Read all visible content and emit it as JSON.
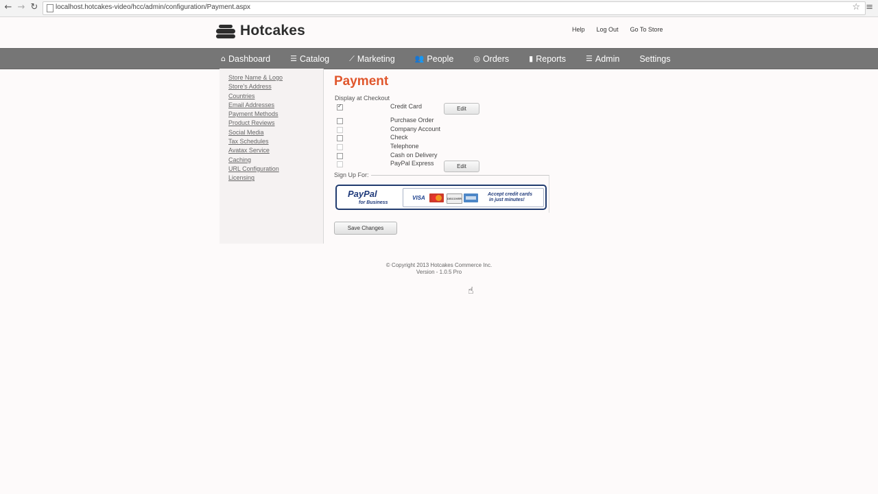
{
  "browser": {
    "url": "localhost.hotcakes-video/hcc/admin/configuration/Payment.aspx",
    "back_icon": "←",
    "forward_icon": "→",
    "reload_icon": "↻",
    "star_icon": "☆",
    "menu_icon": "≡"
  },
  "header": {
    "logo_text": "Hotcakes",
    "links": [
      "Help",
      "Log Out",
      "Go To Store"
    ]
  },
  "nav": {
    "items": [
      {
        "icon": "⌂",
        "label": "Dashboard"
      },
      {
        "icon": "☰",
        "label": "Catalog"
      },
      {
        "icon": "⟋",
        "label": "Marketing"
      },
      {
        "icon": "👥",
        "label": "People"
      },
      {
        "icon": "◎",
        "label": "Orders"
      },
      {
        "icon": "▮",
        "label": "Reports"
      },
      {
        "icon": "☰",
        "label": "Admin"
      },
      {
        "icon": "",
        "label": "Settings"
      }
    ]
  },
  "sidebar": {
    "items": [
      "Store Name & Logo",
      "Store's Address",
      "Countries",
      "Email Addresses",
      "Payment Methods",
      "Product Reviews",
      "Social Media",
      "Tax Schedules",
      "Avatax Service",
      "Caching",
      "URL Configuration",
      "Licensing"
    ]
  },
  "content": {
    "title": "Payment",
    "display_label": "Display at Checkout",
    "methods": [
      {
        "name": "Credit Card",
        "checked": true,
        "enabled": true
      },
      {
        "name": "Purchase Order",
        "checked": false,
        "enabled": true
      },
      {
        "name": "Company Account",
        "checked": false,
        "enabled": false
      },
      {
        "name": "Check",
        "checked": false,
        "enabled": true
      },
      {
        "name": "Telephone",
        "checked": false,
        "enabled": false
      },
      {
        "name": "Cash on Delivery",
        "checked": false,
        "enabled": true
      },
      {
        "name": "PayPal Express",
        "checked": false,
        "enabled": false
      }
    ],
    "edit_label": "Edit",
    "signup_label": "Sign Up For:",
    "paypal": {
      "logo": "PayPal",
      "sub": "for Business",
      "visa": "VISA",
      "discover": "DISCOVER",
      "accept_line1": "Accept credit cards",
      "accept_line2": "in just minutes!"
    },
    "save_label": "Save Changes"
  },
  "footer": {
    "copyright": "© Copyright 2013 Hotcakes Commerce Inc.",
    "version": "Version - 1.0.5 Pro"
  },
  "colors": {
    "accent": "#e0562c",
    "nav_bg": "#767676",
    "paypal_blue": "#1f3a7a"
  }
}
